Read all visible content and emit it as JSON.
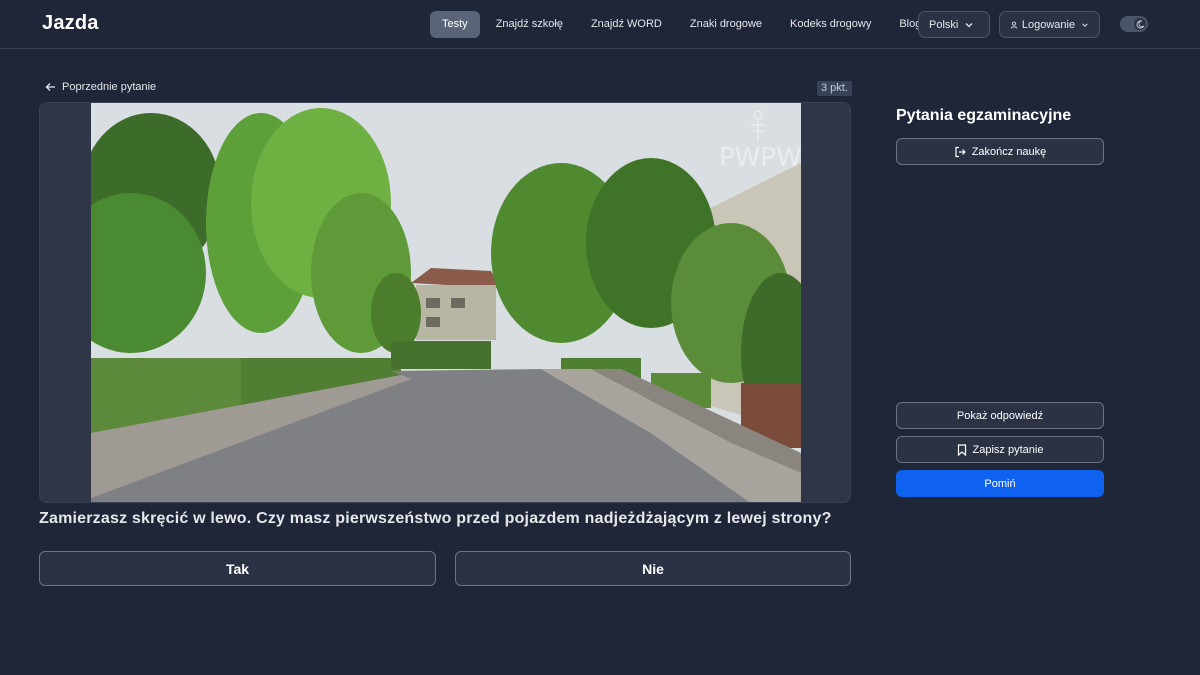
{
  "header": {
    "logo": "Jazda",
    "nav": [
      "Testy",
      "Znajdź szkołę",
      "Znajdź WORD",
      "Znaki drogowe",
      "Kodeks drogowy",
      "Blog"
    ],
    "language": "Polski",
    "login": "Logowanie"
  },
  "question": {
    "back_label": "Poprzednie pytanie",
    "points": "3 pkt.",
    "watermark": "PWPW",
    "text": "Zamierzasz skręcić w lewo. Czy masz pierwszeństwo przed pojazdem nadjeżdżającym z lewej strony?",
    "answers": [
      "Tak",
      "Nie"
    ]
  },
  "sidebar": {
    "title": "Pytania egzaminacyjne",
    "finish_label": "Zakończ naukę",
    "show_answer_label": "Pokaż odpowiedź",
    "save_label": "Zapisz pytanie",
    "skip_label": "Pomiń"
  },
  "colors": {
    "background": "#1f2638",
    "primary": "#0f62f0",
    "active_nav": "#5a6478"
  }
}
